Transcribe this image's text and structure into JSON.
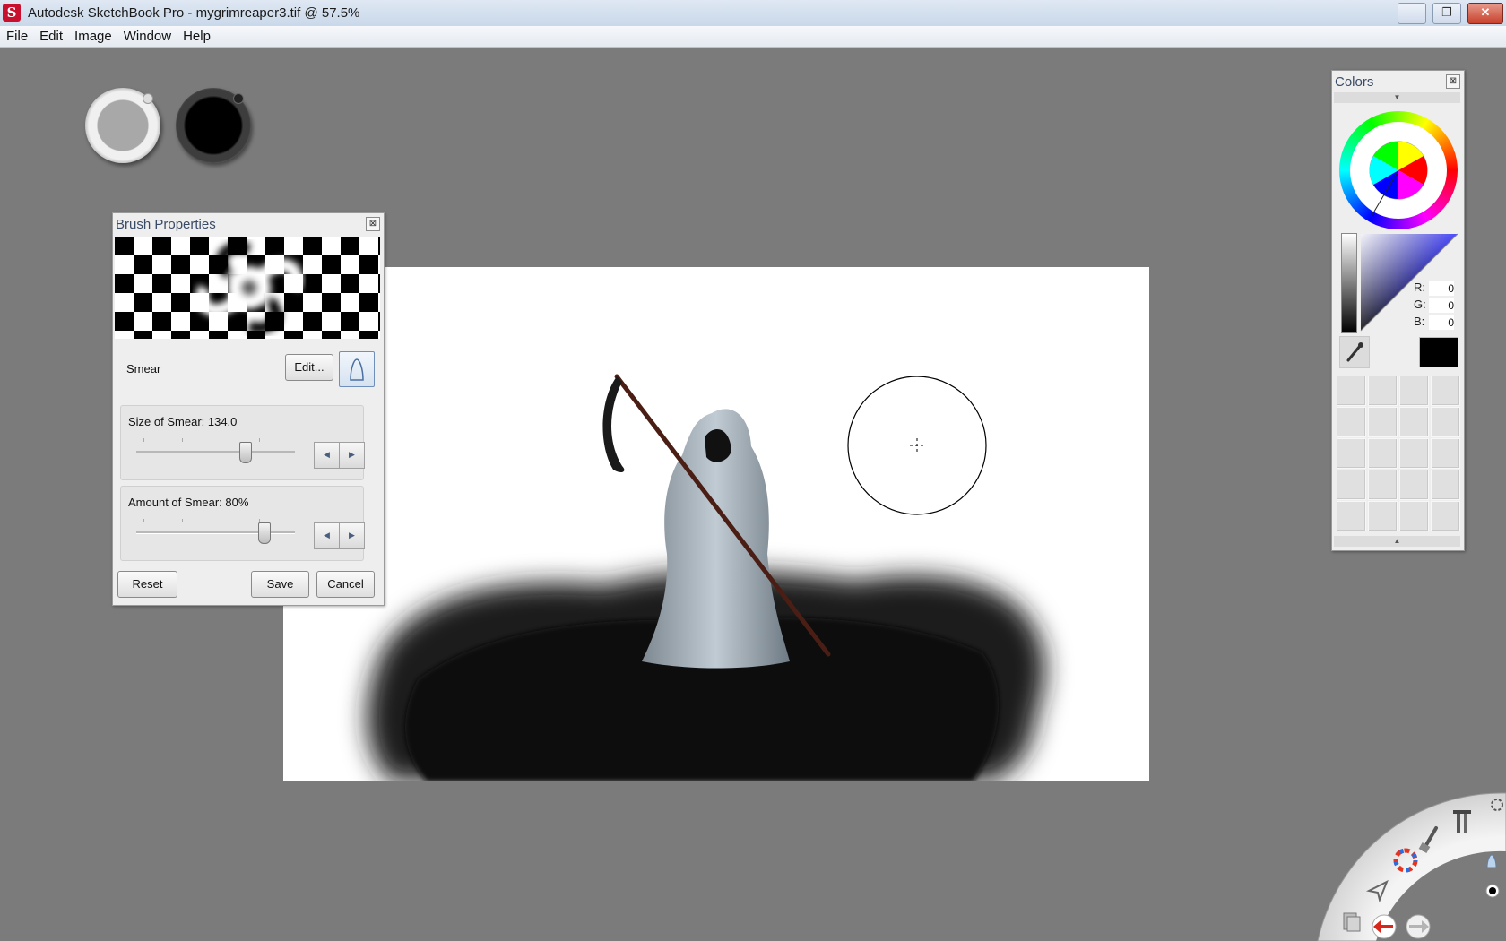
{
  "window": {
    "title": "Autodesk SketchBook Pro - mygrimreaper3.tif @ 57.5%",
    "app_icon_letter": "S",
    "min_glyph": "—",
    "max_glyph": "❐",
    "close_glyph": "✕"
  },
  "menu": [
    "File",
    "Edit",
    "Image",
    "Window",
    "Help"
  ],
  "brush_pucks": {
    "size_color": "#a8a8a8",
    "color_puck": "#000000"
  },
  "brush_properties": {
    "title": "Brush Properties",
    "close_glyph": "⊠",
    "brush_name": "Smear",
    "edit_label": "Edit...",
    "size_label": "Size of Smear: 134.0",
    "size_value": 134.0,
    "size_fraction": 0.62,
    "amount_label": "Amount of Smear: 80%",
    "amount_value": 80,
    "stepper_left": "◀",
    "stepper_right": "▶",
    "reset_label": "Reset",
    "save_label": "Save",
    "cancel_label": "Cancel"
  },
  "colors_panel": {
    "title": "Colors",
    "close_glyph": "⊠",
    "expand_glyph": "▼",
    "collapse_glyph": "▲",
    "r_label": "R:",
    "r_value": "0",
    "g_label": "G:",
    "g_value": "0",
    "b_label": "B:",
    "b_value": "0",
    "current_color": "#000000"
  },
  "lagoon": {
    "icons": [
      "color-wheel-icon",
      "brush-icon",
      "tools-icon",
      "select-icon",
      "layers-icon",
      "undo-icon",
      "redo-icon",
      "settings-icon"
    ]
  }
}
